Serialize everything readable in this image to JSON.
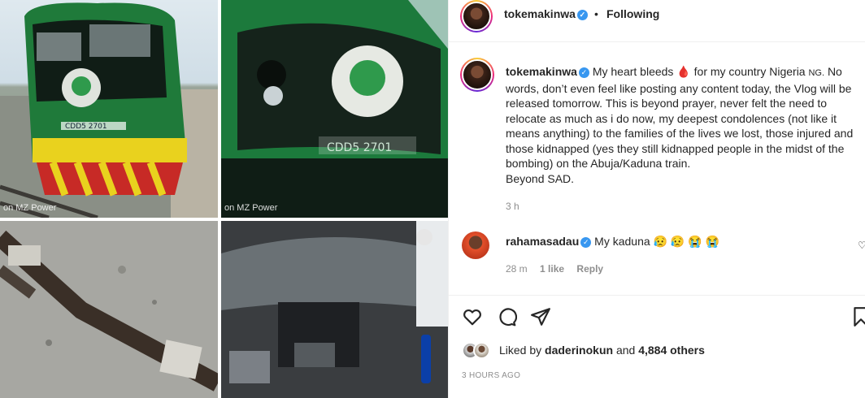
{
  "post_user": "tokemakinwa",
  "follow_label": "Following",
  "header_separator": "•",
  "media": {
    "tile1_watermark": "on MZ Power",
    "tile2_watermark": "on MZ Power"
  },
  "caption": {
    "username": "tokemakinwa",
    "text_1": "My heart bleeds",
    "heart_emoji": "🩸",
    "text_2": "for my country Nigeria",
    "flag_label": "NG.",
    "text_3": "No words, don’t even feel like posting any content today, the Vlog will be released tomorrow. This is beyond prayer, never felt the need to relocate as much as i do now, my deepest condolences (not like it means anything) to the families of the lives we lost, those injured and those kidnapped (yes they still kidnapped people in the midst of the bombing) on the Abuja/Kaduna train.",
    "text_4": "Beyond SAD.",
    "time_ago": "3 h"
  },
  "comment": {
    "username": "rahamasadau",
    "text": "My kaduna 😥 😥 😭 😭",
    "time_ago": "28 m",
    "likes": "1 like",
    "reply_label": "Reply"
  },
  "likes": {
    "prefix": "Liked by",
    "user": "daderinokun",
    "conj": "and",
    "count": "4,884 others"
  },
  "post_time": "3 HOURS AGO",
  "colors": {
    "verified": "#3897f0",
    "text": "#262626",
    "muted": "#8e8e8e"
  }
}
